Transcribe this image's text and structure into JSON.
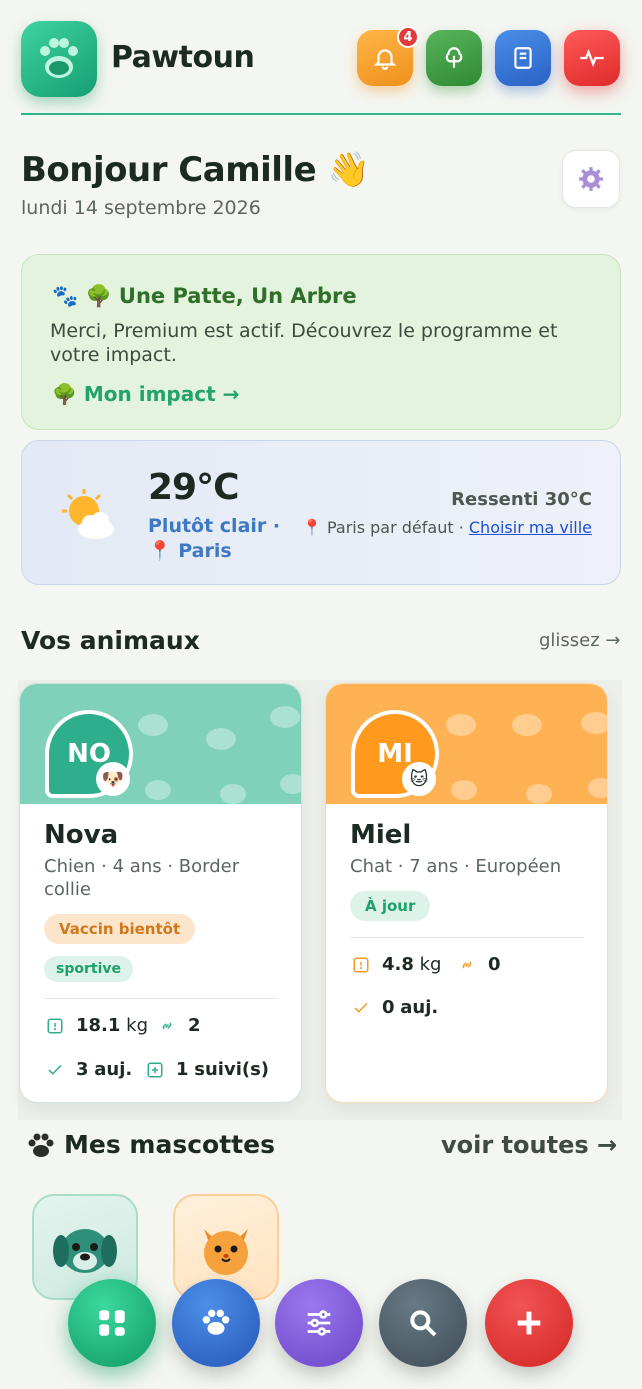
{
  "app": {
    "name": "Pawtoun"
  },
  "header": {
    "notifications_count": "4",
    "icons": [
      "bell-icon",
      "tree-icon",
      "book-icon",
      "pulse-icon"
    ]
  },
  "greeting": {
    "title": "Bonjour Camille 👋",
    "date": "lundi 14 septembre 2026"
  },
  "tree_card": {
    "title": "🐾 🌳 Une Patte, Un Arbre",
    "text": "Merci, Premium est actif. Découvrez le programme et votre impact.",
    "link": "🌳 Mon impact →"
  },
  "weather": {
    "temp": "29°C",
    "condition": "Plutôt clair · 📍 Paris",
    "feels": "Ressenti 30°C",
    "location_text": "📍 Paris par défaut · ",
    "choose_city": "Choisir ma ville"
  },
  "pets_section": {
    "title": "Vos animaux",
    "hint": "glissez →"
  },
  "pets": [
    {
      "initials": "NO",
      "name": "Nova",
      "desc": "Chien · 4 ans · Border collie",
      "status": "Vaccin bientôt",
      "tag": "sportive",
      "weight": "18.1",
      "weight_unit": "kg",
      "links": "2",
      "today": "3",
      "today_label": "auj.",
      "followed": "1",
      "followed_label": "suivi(s)"
    },
    {
      "initials": "MI",
      "name": "Miel",
      "desc": "Chat · 7 ans · Européen",
      "status": "À jour",
      "weight": "4.8",
      "weight_unit": "kg",
      "links": "0",
      "today": "0",
      "today_label": "auj."
    }
  ],
  "mascots": {
    "title": "Mes mascottes",
    "link": "voir toutes →"
  },
  "colors": {
    "accent": "#2fb388",
    "warn": "#d0781a",
    "danger": "#e02a2a"
  }
}
